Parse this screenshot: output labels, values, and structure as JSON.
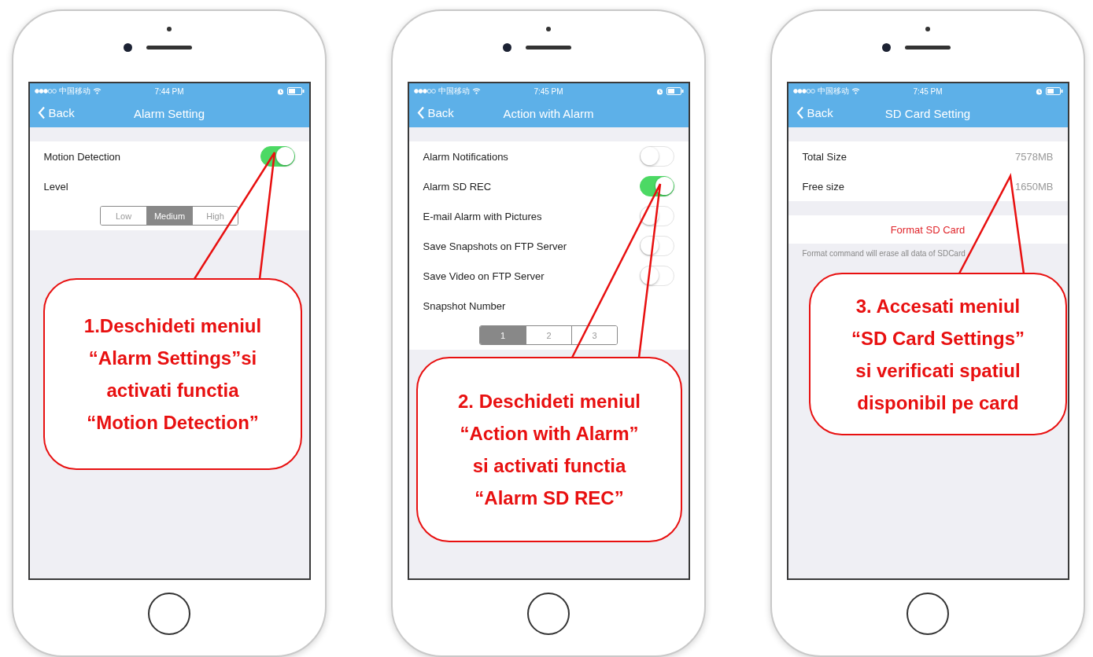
{
  "phones": [
    {
      "status": {
        "carrier": "中国移动",
        "time": "7:44 PM"
      },
      "nav": {
        "back": "Back",
        "title": "Alarm Setting"
      },
      "groups": [
        {
          "rows": [
            {
              "kind": "toggle",
              "label": "Motion Detection",
              "on": true
            },
            {
              "kind": "label",
              "label": "Level"
            },
            {
              "kind": "segmented",
              "options": [
                {
                  "label": "Low",
                  "selected": false
                },
                {
                  "label": "Medium",
                  "selected": true
                },
                {
                  "label": "High",
                  "selected": false
                }
              ]
            }
          ]
        }
      ],
      "callout": {
        "text": "1.Deschideti meniul\n“Alarm Settings”si\nactivati functia\n“Motion Detection”"
      }
    },
    {
      "status": {
        "carrier": "中国移动",
        "time": "7:45 PM"
      },
      "nav": {
        "back": "Back",
        "title": "Action with Alarm"
      },
      "groups": [
        {
          "rows": [
            {
              "kind": "toggle",
              "label": "Alarm Notifications",
              "on": false
            },
            {
              "kind": "toggle",
              "label": "Alarm SD REC",
              "on": true
            },
            {
              "kind": "toggle",
              "label": "E-mail Alarm with Pictures",
              "on": false
            },
            {
              "kind": "toggle",
              "label": "Save Snapshots on FTP Server",
              "on": false
            },
            {
              "kind": "toggle",
              "label": "Save Video on FTP Server",
              "on": false
            },
            {
              "kind": "label",
              "label": "Snapshot Number"
            },
            {
              "kind": "segmented",
              "options": [
                {
                  "label": "1",
                  "selected": true
                },
                {
                  "label": "2",
                  "selected": false
                },
                {
                  "label": "3",
                  "selected": false
                }
              ]
            }
          ]
        }
      ],
      "callout": {
        "text": "2. Deschideti meniul\n“Action with Alarm”\nsi activati functia\n“Alarm SD REC”"
      }
    },
    {
      "status": {
        "carrier": "中国移动",
        "time": "7:45 PM"
      },
      "nav": {
        "back": "Back",
        "title": "SD Card Setting"
      },
      "groups": [
        {
          "rows": [
            {
              "kind": "value",
              "label": "Total Size",
              "value": "7578MB"
            },
            {
              "kind": "value",
              "label": "Free size",
              "value": "1650MB"
            }
          ]
        },
        {
          "rows": [
            {
              "kind": "action",
              "label": "Format SD Card"
            }
          ]
        },
        {
          "rows": [
            {
              "kind": "note",
              "label": "Format command will erase all data of SDCard"
            }
          ]
        }
      ],
      "callout": {
        "text": "3. Accesati meniul\n“SD Card Settings”\nsi verificati spatiul\ndisponibil pe card"
      }
    }
  ]
}
